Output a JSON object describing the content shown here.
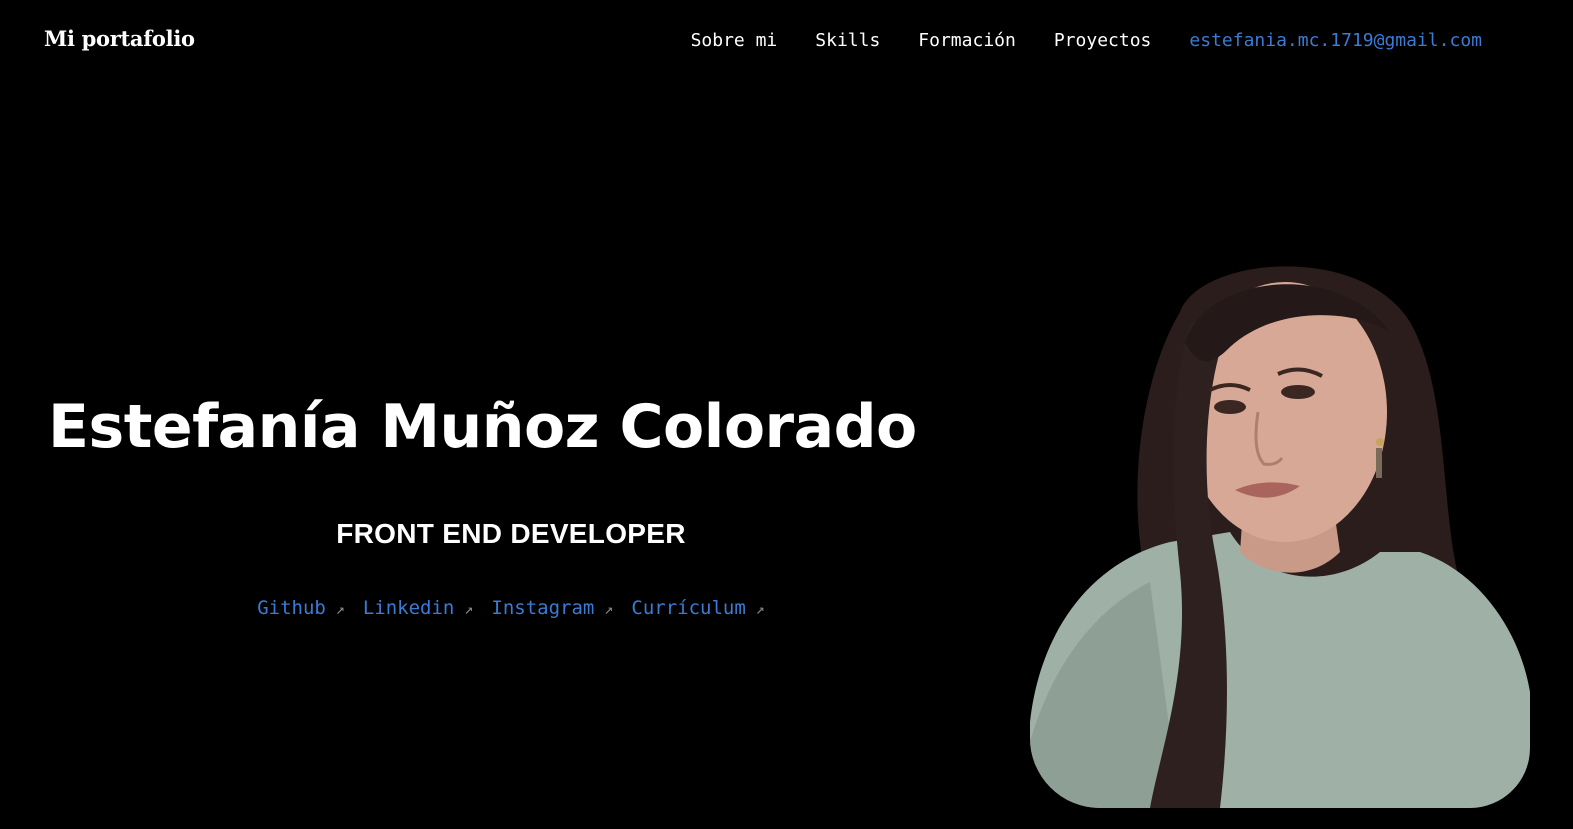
{
  "header": {
    "brand": "Mi portafolio",
    "nav": [
      "Sobre mi",
      "Skills",
      "Formación",
      "Proyectos"
    ],
    "email": "estefania.mc.1719@gmail.com"
  },
  "hero": {
    "name": "Estefanía Muñoz Colorado",
    "role": "FRONT END DEVELOPER",
    "links": [
      "Github",
      "Linkedin",
      "Instagram",
      "Currículum"
    ],
    "link_arrow": "↗"
  },
  "colors": {
    "background": "#000000",
    "text": "#ffffff",
    "link": "#3a7bd5"
  },
  "photo": {
    "icon": "portrait-photo"
  }
}
